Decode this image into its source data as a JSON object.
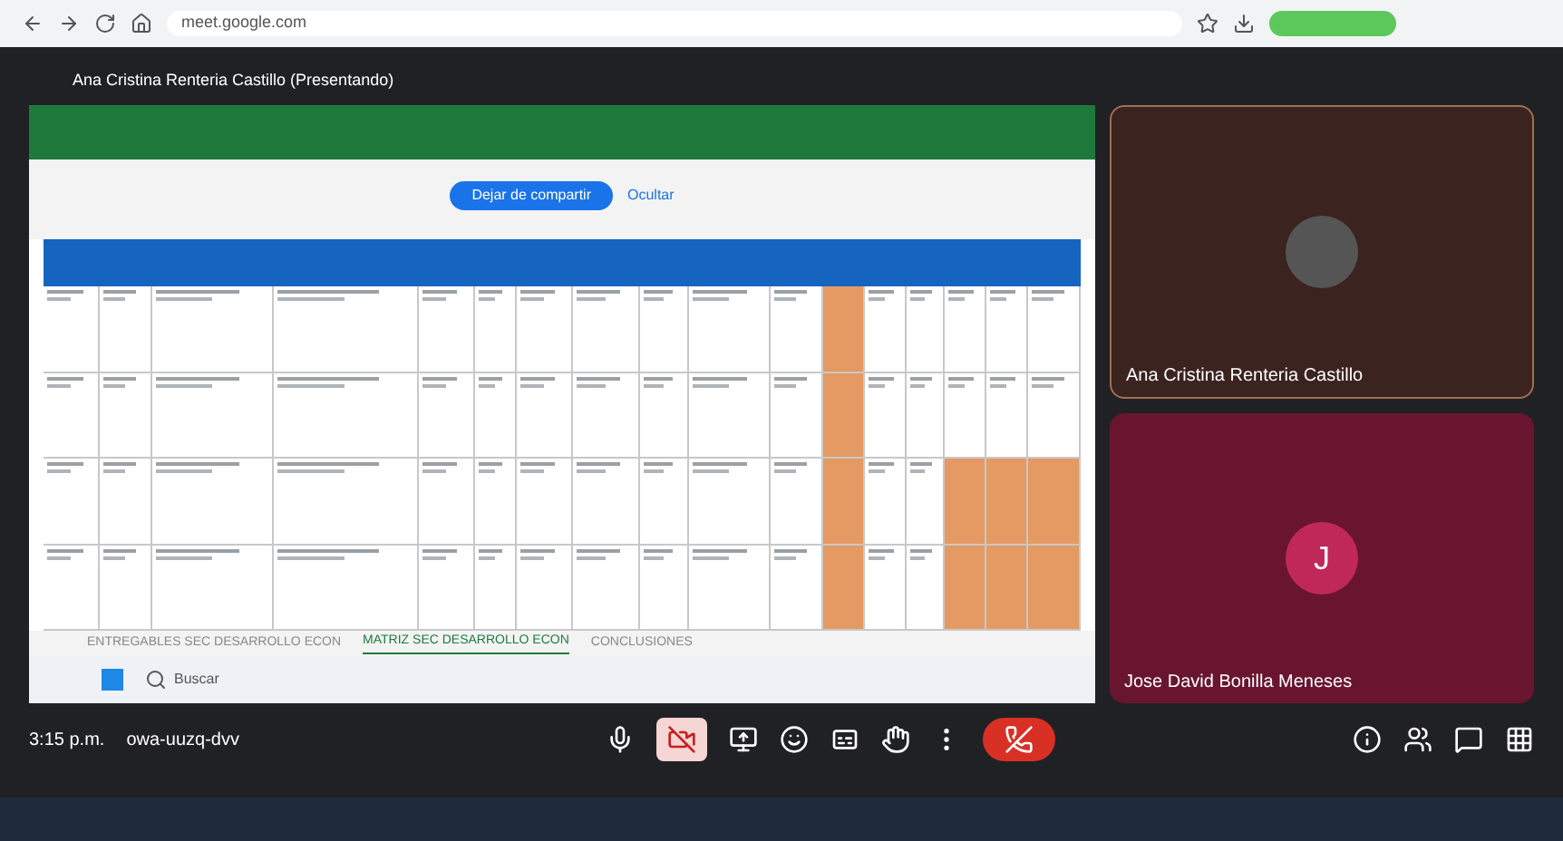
{
  "browser": {
    "url": "meet.google.com"
  },
  "presenter": {
    "title": "Ana Cristina Renteria Castillo (Presentando)"
  },
  "share_banner": {
    "stop_button": "Dejar de compartir",
    "hide_link": "Ocultar"
  },
  "sheet": {
    "rows": [
      {
        "highlighted": [
          false,
          false,
          false,
          false,
          false,
          false,
          false,
          false,
          false,
          false,
          false,
          true,
          false,
          false,
          false,
          false,
          false
        ]
      },
      {
        "highlighted": [
          false,
          false,
          false,
          false,
          false,
          false,
          false,
          false,
          false,
          false,
          false,
          true,
          false,
          false,
          false,
          false,
          false
        ]
      },
      {
        "highlighted": [
          false,
          false,
          false,
          false,
          false,
          false,
          false,
          false,
          false,
          false,
          false,
          true,
          false,
          false,
          true,
          true,
          true
        ]
      },
      {
        "highlighted": [
          false,
          false,
          false,
          false,
          false,
          false,
          false,
          false,
          false,
          false,
          false,
          true,
          false,
          false,
          true,
          true,
          true
        ]
      }
    ],
    "tabs": [
      {
        "label": "ENTREGABLES SEC DESARROLLO ECON",
        "selected": false
      },
      {
        "label": "MATRIZ SEC DESARROLLO ECON",
        "selected": true
      },
      {
        "label": "CONCLUSIONES",
        "selected": false
      }
    ]
  },
  "inner_taskbar": {
    "search": "Buscar"
  },
  "participants": [
    {
      "name": "Ana Cristina Renteria Castillo",
      "kind": "video"
    },
    {
      "name": "Jose David Bonilla Meneses",
      "kind": "avatar",
      "initial": "J"
    }
  ],
  "meeting": {
    "time": "3:15 p.m.",
    "code": "owa-uuzq-dvv",
    "camera_on": false
  }
}
